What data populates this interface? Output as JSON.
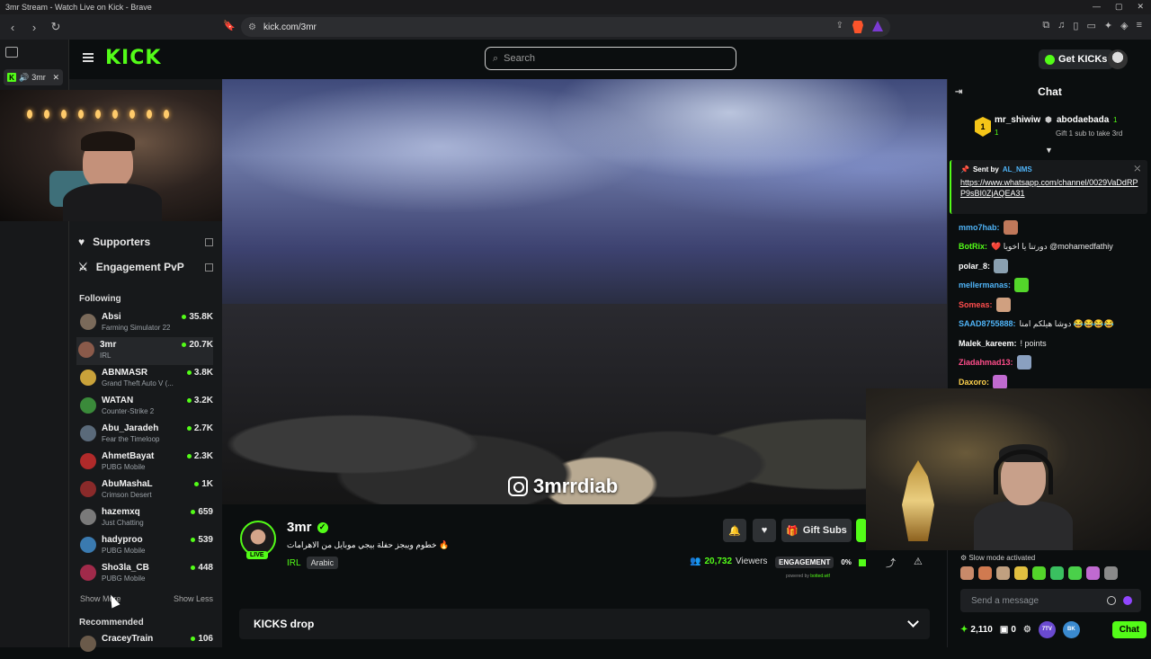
{
  "browser": {
    "window_title": "3mr Stream - Watch Live on Kick - Brave",
    "url": "kick.com/3mr",
    "tab_label": "3mr"
  },
  "header": {
    "logo": "KICK",
    "search_placeholder": "Search",
    "get_kicks": "Get KICKs"
  },
  "sidebar": {
    "menu_items": [
      {
        "label": "Supporters"
      },
      {
        "label": "Engagement PvP"
      }
    ],
    "following_heading": "Following",
    "channels": [
      {
        "name": "Absi",
        "game": "Farming Simulator 22",
        "viewers": "35.8K",
        "color": "#7a6a5a"
      },
      {
        "name": "3mr",
        "game": "IRL",
        "viewers": "20.7K",
        "color": "#8a5a4a"
      },
      {
        "name": "ABNMASR",
        "game": "Grand Theft Auto V (...",
        "viewers": "3.8K",
        "color": "#c9a23a"
      },
      {
        "name": "WATAN",
        "game": "Counter-Strike 2",
        "viewers": "3.2K",
        "color": "#3a8a3a"
      },
      {
        "name": "Abu_Jaradeh",
        "game": "Fear the Timeloop",
        "viewers": "2.7K",
        "color": "#5a6a7a"
      },
      {
        "name": "AhmetBayat",
        "game": "PUBG Mobile",
        "viewers": "2.3K",
        "color": "#b02a2a"
      },
      {
        "name": "AbuMashaL",
        "game": "Crimson Desert",
        "viewers": "1K",
        "color": "#8a2a2a"
      },
      {
        "name": "hazemxq",
        "game": "Just Chatting",
        "viewers": "659",
        "color": "#7a7a7a"
      },
      {
        "name": "hadyproo",
        "game": "PUBG Mobile",
        "viewers": "539",
        "color": "#3a7ab0"
      },
      {
        "name": "Sho3la_CB",
        "game": "PUBG Mobile",
        "viewers": "448",
        "color": "#a02a4a"
      }
    ],
    "show_more": "Show More",
    "show_less": "Show Less",
    "recommended_heading": "Recommended",
    "recommended": [
      {
        "name": "CraceyTrain",
        "viewers": "106",
        "color": "#6a5a4a"
      }
    ]
  },
  "video": {
    "watermark": "3mrrdiab"
  },
  "stream_info": {
    "channel_name": "3mr",
    "live_badge": "LIVE",
    "title": "خطوم ويبجز حفلة بيجي موبايل من الاهرامات 🔥",
    "category": "IRL",
    "language": "Arabic",
    "gift_subs": "Gift Subs",
    "viewers": "20,732",
    "viewers_label": "Viewers",
    "engagement_label": "ENGAGEMENT",
    "engagement_value": "0%",
    "powered_by_prefix": "powered by",
    "powered_by_brand": "botted.wtf",
    "kicks_drop": "KICKS drop"
  },
  "chat": {
    "title": "Chat",
    "top_gifters": [
      {
        "name": "mr_shiwiw",
        "count": "1",
        "rank": "1"
      },
      {
        "name": "abodaebada",
        "count": "1"
      }
    ],
    "gift_prompt": "Gift 1 sub to take 3rd",
    "pinned": {
      "sent_by_label": "Sent by",
      "sender": "AL_NMS",
      "link": "https://www.whatsapp.com/channel/0029VaDdRPP9sBI0ZjAQEA31"
    },
    "messages": [
      {
        "user": "mmo7hab:",
        "text": "",
        "color": "#4fb3f6",
        "emote": "#c0785a"
      },
      {
        "user": "BotRix:",
        "text": "❤️ دورتنا يا اخويا @mohamedfathiy",
        "color": "#53fc18",
        "emote": ""
      },
      {
        "user": "polar_8:",
        "text": "",
        "color": "#ffffff",
        "emote": "#8aa0b0"
      },
      {
        "user": "mellermanas:",
        "text": "",
        "color": "#4fb3f6",
        "emote": "#53d62a"
      },
      {
        "user": "Someas:",
        "text": "",
        "color": "#ff4d4d",
        "emote": "#d0a080"
      },
      {
        "user": "SAAD8755888:",
        "text": "دوشا هيلكم امنا 😂😂😂😂",
        "color": "#4fb3f6",
        "emote": ""
      },
      {
        "user": "Malek_kareem:",
        "text": "! points",
        "color": "#ffffff",
        "emote": ""
      },
      {
        "user": "Ziadahmad13:",
        "text": "",
        "color": "#ff4d8a",
        "emote": "#8aa0c0"
      },
      {
        "user": "Daxoro:",
        "text": "",
        "color": "#ffd24d",
        "emote": "#c06ad0"
      }
    ],
    "slow_mode": "Slow mode activated",
    "input_placeholder": "Send a message",
    "points": "2,110",
    "counter": "0",
    "badge_7tv": "7TV",
    "badge_bk": "BK",
    "chat_button": "Chat"
  },
  "colors": {
    "accent": "#53fc18",
    "background": "#0b0e0f",
    "panel": "#17191b"
  }
}
